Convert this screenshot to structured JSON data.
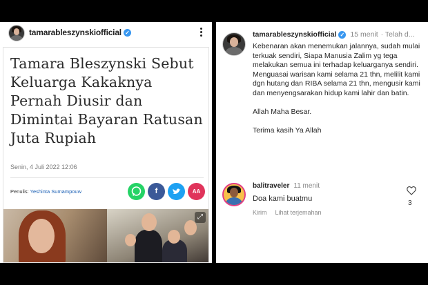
{
  "post": {
    "username": "tamarableszynskiofficial",
    "article": {
      "headline": "Tamara Bleszynski Sebut Keluarga Kakaknya Pernah Diusir dan Dimintai Bayaran Ratusan Juta Rupiah",
      "date": "Senin, 4 Juli 2022 12:06",
      "author_label": "Penulis:",
      "author_name": "Yeshinta Sumampouw",
      "share_buttons": [
        "whatsapp-icon",
        "facebook-icon",
        "twitter-icon",
        "font-size-icon"
      ],
      "font_size_label": "AA"
    }
  },
  "caption": {
    "username": "tamarableszynskiofficial",
    "time": "15 menit",
    "edited": "· Telah d...",
    "paragraphs": [
      "Kebenaran akan menemukan jalannya, sudah mulai terkuak sendiri, Siapa Manusia Zalim yg tega melakukan semua ini terhadap keluarganya sendiri. Menguasai warisan kami selama 21 thn, melilit kami dgn hutang dan RIBA selama 21 thn, mengusir kami dan menyengsarakan hidup kami lahir dan batin.",
      "Allah Maha Besar.",
      "Terima kasih Ya Allah"
    ]
  },
  "comment": {
    "username": "balitraveler",
    "time": "11 menit",
    "text": "Doa kami buatmu",
    "reply": "Kirim",
    "translate": "Lihat terjemahan",
    "likes": "3"
  },
  "colors": {
    "verified": "#3897f0",
    "whatsapp": "#25d366",
    "facebook": "#3b5998",
    "twitter": "#1da1f2",
    "accent": "#e0345b"
  }
}
